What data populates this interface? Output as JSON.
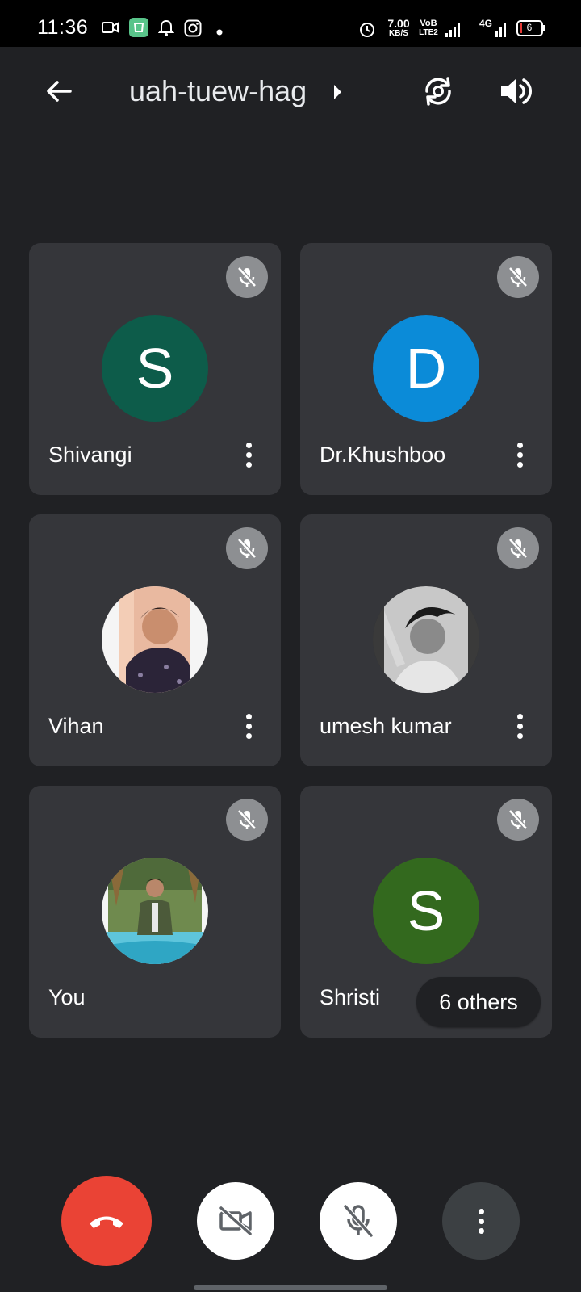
{
  "status_bar": {
    "time": "11:36",
    "speed_value": "7.00",
    "speed_unit": "KB/S",
    "volte_top": "VoB",
    "volte_bottom": "LTE2",
    "network": "4G",
    "battery": "6",
    "icons": [
      "video-camera-icon",
      "app-icon",
      "bell-icon",
      "instagram-icon",
      "dot-icon",
      "alarm-icon",
      "signal-icon",
      "battery-icon"
    ]
  },
  "top_bar": {
    "meeting_code": "uah-tuew-hag",
    "icons": [
      "back-arrow-icon",
      "chevron-right-icon",
      "switch-camera-icon",
      "speaker-icon"
    ]
  },
  "participants": [
    {
      "name": "Shivangi",
      "initial": "S",
      "avatar_color": "#0d5c4a",
      "muted": true,
      "has_photo": false
    },
    {
      "name": "Dr.Khushboo",
      "initial": "D",
      "avatar_color": "#0b8bd8",
      "muted": true,
      "has_photo": false
    },
    {
      "name": "Vihan",
      "initial": "",
      "avatar_color": "#f2d4c4",
      "muted": true,
      "has_photo": true
    },
    {
      "name": "umesh kumar",
      "initial": "",
      "avatar_color": "#6e6e6e",
      "muted": true,
      "has_photo": true
    },
    {
      "name": "You",
      "initial": "",
      "avatar_color": "#6a8a5c",
      "muted": true,
      "has_photo": true
    },
    {
      "name": "Shristi",
      "initial": "S",
      "avatar_color": "#33691e",
      "muted": true,
      "has_photo": false
    }
  ],
  "others_chip": "6 others",
  "controls": {
    "icons": [
      "end-call-icon",
      "camera-off-icon",
      "mic-off-icon",
      "more-vert-icon"
    ],
    "colors": {
      "end_call": "#ea4335",
      "camera": "#ffffff",
      "mic": "#ffffff",
      "more": "#3c4043"
    }
  }
}
